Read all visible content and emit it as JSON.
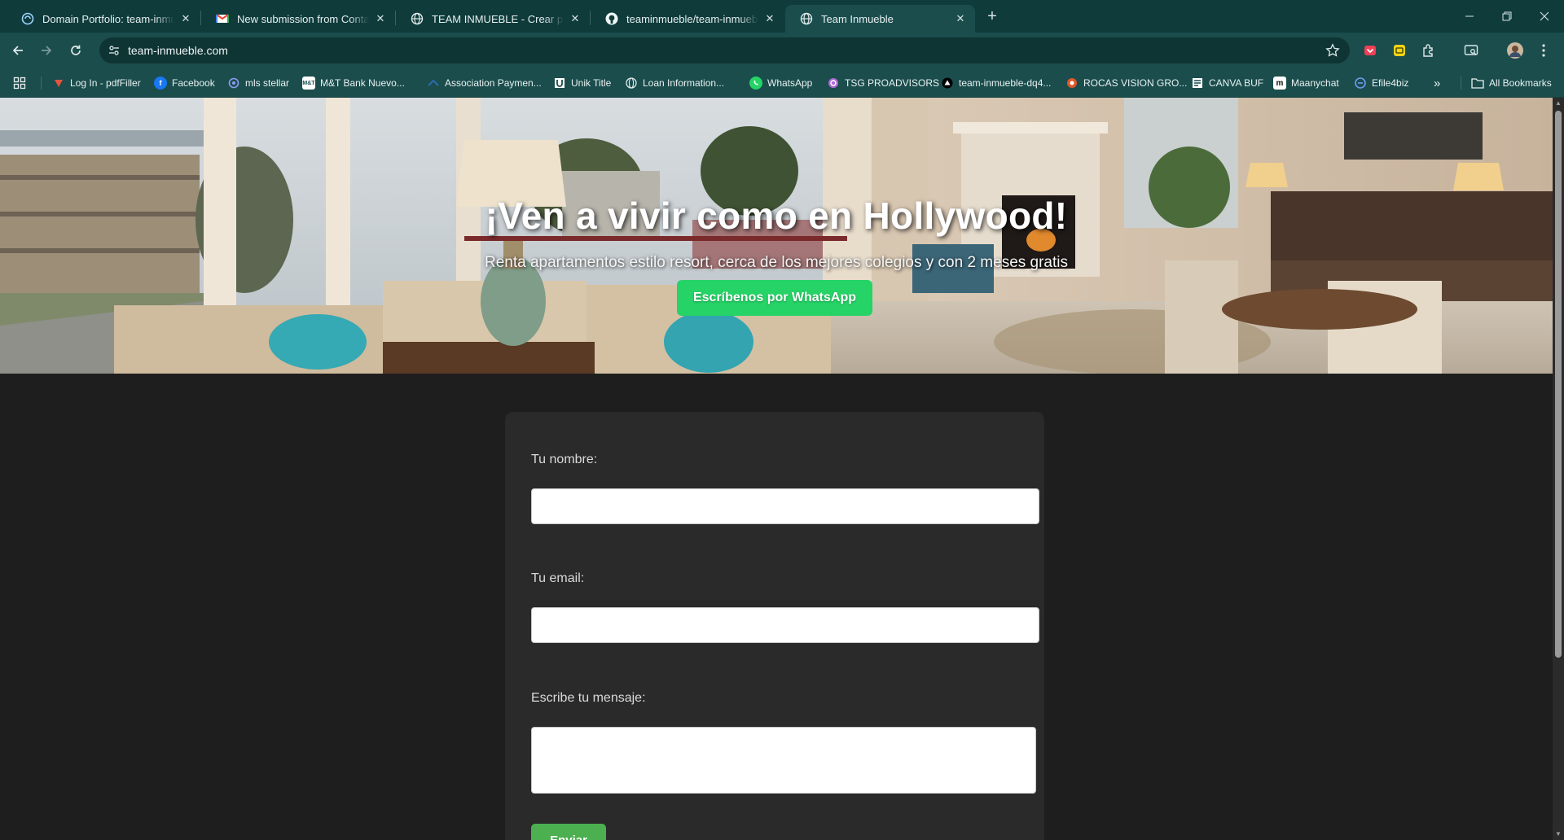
{
  "browser": {
    "tabs": [
      {
        "title": "Domain Portfolio: team-inmueble.com",
        "icon": "webflow-icon"
      },
      {
        "title": "New submission from Contacto",
        "icon": "gmail-icon"
      },
      {
        "title": "TEAM INMUEBLE - Crear página",
        "icon": "globe-icon"
      },
      {
        "title": "teaminmueble/team-inmueble",
        "icon": "github-icon"
      },
      {
        "title": "Team Inmueble",
        "icon": "globe-icon",
        "active": true
      }
    ],
    "new_tab": "+",
    "url": "team-inmueble.com",
    "bookmarks": [
      {
        "label": "Log In - pdfFiller",
        "color": "#e5533d"
      },
      {
        "label": "Facebook",
        "color": "#1877f2"
      },
      {
        "label": "mls stellar",
        "color": "#5b6bd5"
      },
      {
        "label": "M&T Bank Nuevo...",
        "color": "#ffffff"
      },
      {
        "label": "Association Paymen...",
        "color": "#2b6cb0"
      },
      {
        "label": "Unik Title",
        "color": "#ffffff"
      },
      {
        "label": "Loan Information...",
        "color": "#d9e6e6"
      },
      {
        "label": "WhatsApp",
        "color": "#25d366"
      },
      {
        "label": "TSG PROADVISORS",
        "color": "#b06ad6"
      },
      {
        "label": "team-inmueble-dq4...",
        "color": "#000000"
      },
      {
        "label": "ROCAS VISION GRO...",
        "color": "#e0572a"
      },
      {
        "label": "CANVA BUF",
        "color": "#ffffff"
      },
      {
        "label": "Maanychat",
        "color": "#ffffff"
      },
      {
        "label": "Efile4biz",
        "color": "#3c6fd8"
      }
    ],
    "more_bookmarks": "»",
    "all_bookmarks": "All Bookmarks"
  },
  "hero": {
    "title": "¡Ven a vivir como en Hollywood!",
    "subtitle": "Renta apartamentos estilo resort, cerca de los mejores colegios y con 2 meses gratis",
    "cta": "Escríbenos por WhatsApp",
    "cta_color": "#25d366"
  },
  "form": {
    "name_label": "Tu nombre:",
    "name_value": "",
    "email_label": "Tu email:",
    "email_value": "",
    "message_label": "Escribe tu mensaje:",
    "message_value": "",
    "submit": "Enviar",
    "submit_color": "#4caf50"
  },
  "theme": {
    "tab_bar": "#0f3b3b",
    "toolbar": "#1b4d4d",
    "page_bg": "#1e1e1e",
    "card_bg": "#2a2a2a"
  }
}
